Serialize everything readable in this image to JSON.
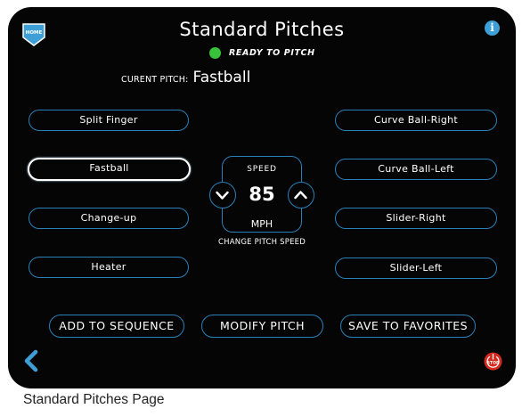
{
  "header": {
    "home_label": "HOME",
    "title": "Standard Pitches",
    "info_icon": "info-icon",
    "info_glyph": "i"
  },
  "status": {
    "indicator_color": "#37c43a",
    "text": "READY TO PITCH"
  },
  "current_pitch": {
    "label": "CURENT PITCH:",
    "value": "Fastball"
  },
  "left_pitches": [
    {
      "label": "Split Finger",
      "selected": false
    },
    {
      "label": "Fastball",
      "selected": true
    },
    {
      "label": "Change-up",
      "selected": false
    },
    {
      "label": "Heater",
      "selected": false
    }
  ],
  "right_pitches": [
    {
      "label": "Curve Ball-Right",
      "selected": false
    },
    {
      "label": "Curve Ball-Left",
      "selected": false
    },
    {
      "label": "Slider-Right",
      "selected": false
    },
    {
      "label": "Slider-Left",
      "selected": false
    }
  ],
  "speed": {
    "label": "SPEED",
    "value": "85",
    "unit": "MPH",
    "caption": "CHANGE PITCH SPEED",
    "decrease_icon": "chevron-down-icon",
    "increase_icon": "chevron-up-icon"
  },
  "actions": {
    "add_to_sequence": "ADD TO SEQUENCE",
    "modify_pitch": "MODIFY PITCH",
    "save_to_favorites": "SAVE TO FAVORITES"
  },
  "footer": {
    "back_icon": "chevron-left-icon",
    "stop_label": "STOP",
    "stop_color": "#d42a1e"
  },
  "colors": {
    "background": "#050505",
    "accent": "#2a80b8",
    "info": "#3d9fd6",
    "text": "#ffffff"
  },
  "caption": "Standard Pitches Page"
}
